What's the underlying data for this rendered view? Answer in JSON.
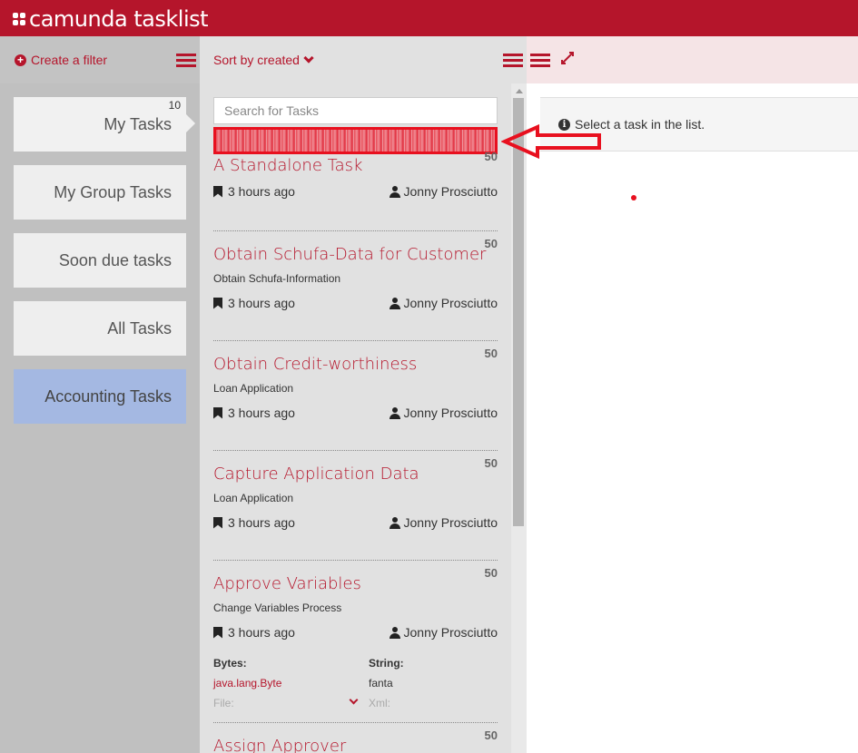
{
  "app": {
    "title": "camunda tasklist"
  },
  "filters": {
    "create_label": "Create a filter",
    "items": [
      {
        "label": "My Tasks",
        "count": "10"
      },
      {
        "label": "My Group Tasks"
      },
      {
        "label": "Soon due tasks"
      },
      {
        "label": "All Tasks"
      },
      {
        "label": "Accounting Tasks"
      }
    ]
  },
  "list": {
    "sort_label": "Sort by created",
    "search_placeholder": "Search for Tasks",
    "tasks": [
      {
        "title": "A Standalone Task",
        "priority": "50",
        "subtitle": "",
        "created": "3 hours ago",
        "assignee": "Jonny Prosciutto"
      },
      {
        "title": "Obtain Schufa-Data for Customer",
        "priority": "50",
        "subtitle": "Obtain Schufa-Information",
        "created": "3 hours ago",
        "assignee": "Jonny Prosciutto"
      },
      {
        "title": "Obtain Credit-worthiness",
        "priority": "50",
        "subtitle": "Loan Application",
        "created": "3 hours ago",
        "assignee": "Jonny Prosciutto"
      },
      {
        "title": "Capture Application Data",
        "priority": "50",
        "subtitle": "Loan Application",
        "created": "3 hours ago",
        "assignee": "Jonny Prosciutto"
      },
      {
        "title": "Approve Variables",
        "priority": "50",
        "subtitle": "Change Variables Process",
        "created": "3 hours ago",
        "assignee": "Jonny Prosciutto"
      },
      {
        "title": "Assign Approver",
        "priority": "50"
      }
    ],
    "variables": [
      {
        "label": "Bytes:",
        "value": "java.lang.Byte",
        "next": "File:"
      },
      {
        "label": "String:",
        "value": "fanta",
        "next": "Xml:"
      }
    ]
  },
  "detail": {
    "empty_message": "Select a task in the list."
  },
  "colors": {
    "brand": "#b5152b",
    "highlight_filter": "#a4b8e2",
    "annotation": "#e8101f"
  }
}
